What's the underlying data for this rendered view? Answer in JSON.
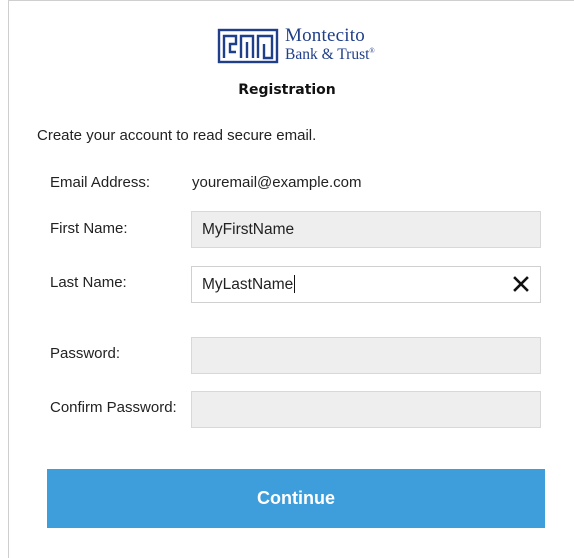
{
  "brand": {
    "line1": "Montecito",
    "line2": "Bank & Trust",
    "mark": "®",
    "logo_icon": "mbt-logo-icon",
    "color": "#1f3f8a"
  },
  "page": {
    "title": "Registration",
    "intro": "Create your account to read secure email."
  },
  "form": {
    "email_label": "Email Address:",
    "email_value": "youremail@example.com",
    "first_name_label": "First Name:",
    "first_name_value": "MyFirstName",
    "last_name_label": "Last Name:",
    "last_name_value": "MyLastName",
    "clear_icon": "close-icon",
    "password_label": "Password:",
    "password_value": "",
    "confirm_password_label": "Confirm Password:",
    "confirm_password_value": ""
  },
  "actions": {
    "continue_label": "Continue",
    "continue_color": "#3e9edb"
  }
}
